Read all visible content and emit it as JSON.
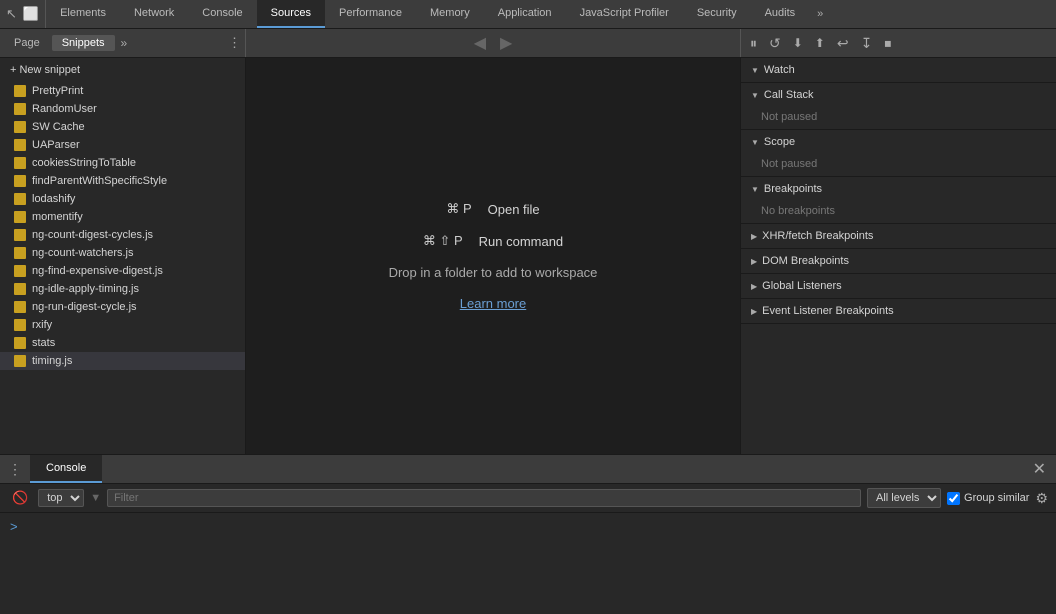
{
  "topNav": {
    "icons": [
      "↖",
      "⬜"
    ],
    "tabs": [
      {
        "label": "Elements",
        "active": false
      },
      {
        "label": "Network",
        "active": false
      },
      {
        "label": "Console",
        "active": false
      },
      {
        "label": "Sources",
        "active": true
      },
      {
        "label": "Performance",
        "active": false
      },
      {
        "label": "Memory",
        "active": false
      },
      {
        "label": "Application",
        "active": false
      },
      {
        "label": "JavaScript Profiler",
        "active": false
      },
      {
        "label": "Security",
        "active": false
      },
      {
        "label": "Audits",
        "active": false
      }
    ],
    "more": "»"
  },
  "toolbar": {
    "tabs": [
      {
        "label": "Page",
        "active": false
      },
      {
        "label": "Snippets",
        "active": true
      }
    ],
    "moreBtn": "»",
    "centerBtns": [
      "◀",
      "▶"
    ],
    "rightBtns": [
      "⏸",
      "↺",
      "⬇",
      "⬆",
      "↩",
      "↧",
      "⏹"
    ]
  },
  "snippets": {
    "newLabel": "+ New snippet",
    "items": [
      "PrettyPrint",
      "RandomUser",
      "SW Cache",
      "UAParser",
      "cookiesStringToTable",
      "findParentWithSpecificStyle",
      "lodashify",
      "momentify",
      "ng-count-digest-cycles.js",
      "ng-count-watchers.js",
      "ng-find-expensive-digest.js",
      "ng-idle-apply-timing.js",
      "ng-run-digest-cycle.js",
      "rxify",
      "stats",
      "timing.js"
    ]
  },
  "center": {
    "shortcut1": {
      "keys": "⌘ P",
      "desc": "Open file"
    },
    "shortcut2": {
      "keys": "⌘ ⇧ P",
      "desc": "Run command"
    },
    "dropText": "Drop in a folder to add to workspace",
    "learnMore": "Learn more"
  },
  "rightPanel": {
    "sections": [
      {
        "id": "watch",
        "label": "Watch",
        "expanded": true,
        "content": null
      },
      {
        "id": "callStack",
        "label": "Call Stack",
        "expanded": true,
        "content": "Not paused"
      },
      {
        "id": "scope",
        "label": "Scope",
        "expanded": true,
        "content": "Not paused"
      },
      {
        "id": "breakpoints",
        "label": "Breakpoints",
        "expanded": true,
        "content": "No breakpoints"
      },
      {
        "id": "xhrBreakpoints",
        "label": "XHR/fetch Breakpoints",
        "expanded": false,
        "content": null
      },
      {
        "id": "domBreakpoints",
        "label": "DOM Breakpoints",
        "expanded": false,
        "content": null
      },
      {
        "id": "globalListeners",
        "label": "Global Listeners",
        "expanded": false,
        "content": null
      },
      {
        "id": "eventListenerBreakpoints",
        "label": "Event Listener Breakpoints",
        "expanded": false,
        "content": null
      }
    ]
  },
  "console": {
    "tabLabel": "Console",
    "closeBtn": "✕",
    "filterPlaceholder": "Filter",
    "levelOptions": [
      "All levels"
    ],
    "levelSelected": "All levels",
    "groupSimilar": "Group similar",
    "topValue": "top",
    "prompt": ">"
  }
}
